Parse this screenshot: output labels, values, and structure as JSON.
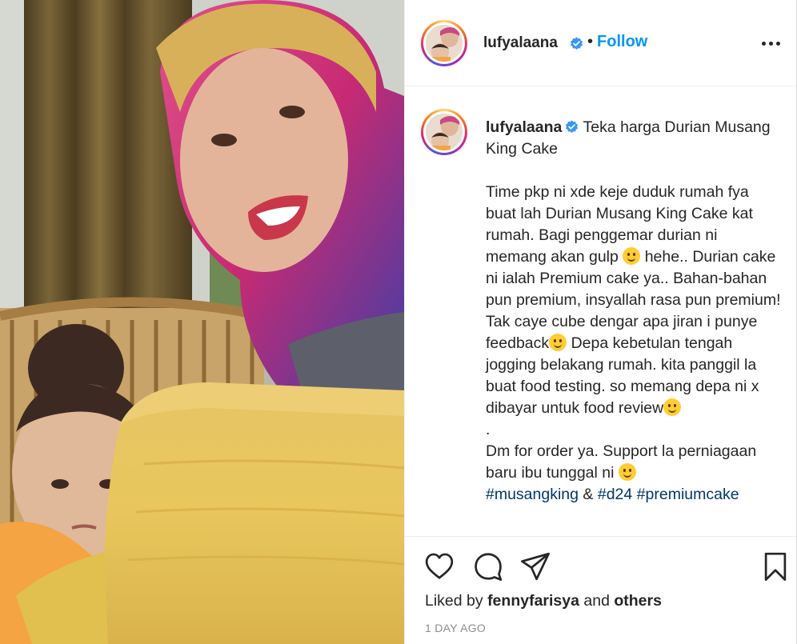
{
  "post": {
    "username": "lufyalaana",
    "verified": true,
    "follow_separator": "•",
    "follow_label": "Follow",
    "more_options_label": "More options"
  },
  "caption": {
    "username": "lufyalaana",
    "title": "Teka harga Durian Musang King Cake",
    "paragraphs": [
      "Time pkp ni xde keje duduk rumah fya buat lah Durian Musang King Cake kat rumah. Bagi penggemar durian ni memang akan gulp",
      "hehe.. Durian cake ni ialah Premium cake ya.. Bahan-bahan pun premium, insyallah rasa pun premium! Tak caye cube dengar apa jiran i punye feedback",
      "Depa kebetulan tengah jogging belakang rumah. kita panggil la buat food testing. so memang depa ni x dibayar untuk food review",
      ".",
      "Dm for order ya. Support la perniagaan baru ibu tunggal ni",
      "&"
    ],
    "hashtags": [
      "#musangking",
      "#d24",
      "#premiumcake"
    ]
  },
  "actions": {
    "like_icon": "heart-icon",
    "comment_icon": "comment-icon",
    "share_icon": "paper-plane-icon",
    "save_icon": "bookmark-icon"
  },
  "likes": {
    "prefix": "Liked by",
    "user": "fennyfarisya",
    "joiner": "and",
    "others": "others"
  },
  "timestamp": "1 DAY AGO",
  "colors": {
    "accent": "#0095f6",
    "hashtag": "#00376b",
    "text": "#262626",
    "muted": "#8e8e8e"
  }
}
